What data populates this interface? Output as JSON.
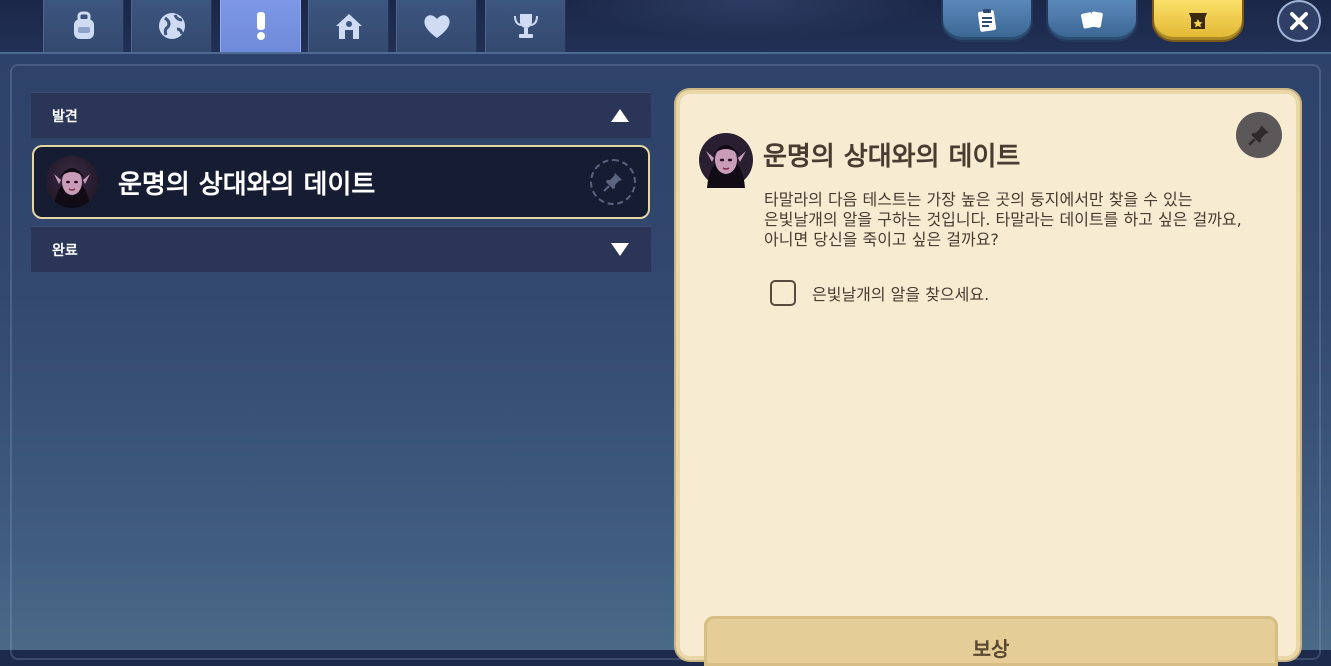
{
  "top_tabs": [
    {
      "icon": "backpack-icon",
      "active": false
    },
    {
      "icon": "globe-icon",
      "active": false
    },
    {
      "icon": "exclamation-icon",
      "active": true
    },
    {
      "icon": "house-icon",
      "active": false
    },
    {
      "icon": "heart-icon",
      "active": false
    },
    {
      "icon": "trophy-icon",
      "active": false
    }
  ],
  "top_buttons": [
    {
      "icon": "clipboard-icon"
    },
    {
      "icon": "cards-icon"
    },
    {
      "icon": "shop-icon"
    }
  ],
  "close_icon": "close-icon",
  "quest_list": {
    "category_discovered": "발견",
    "category_completed": "완료",
    "selected_quest": {
      "title": "운명의 상대와의 데이트"
    }
  },
  "detail": {
    "title": "운명의 상대와의 데이트",
    "description_lines": [
      "타말라의 다음 테스트는 가장 높은 곳의 둥지에서만 찾을 수 있는",
      "은빛날개의 알을 구하는 것입니다. 타말라는 데이트를 하고 싶은 걸까요,",
      "아니면 당신을 죽이고 싶은 걸까요?"
    ],
    "objective": "은빛날개의 알을 찾으세요.",
    "reward_label": "보상"
  },
  "colors": {
    "active_tab": "#7d98e6",
    "panel": "#2d426a",
    "card": "#f7ebd2",
    "gold": "#e1b531"
  }
}
